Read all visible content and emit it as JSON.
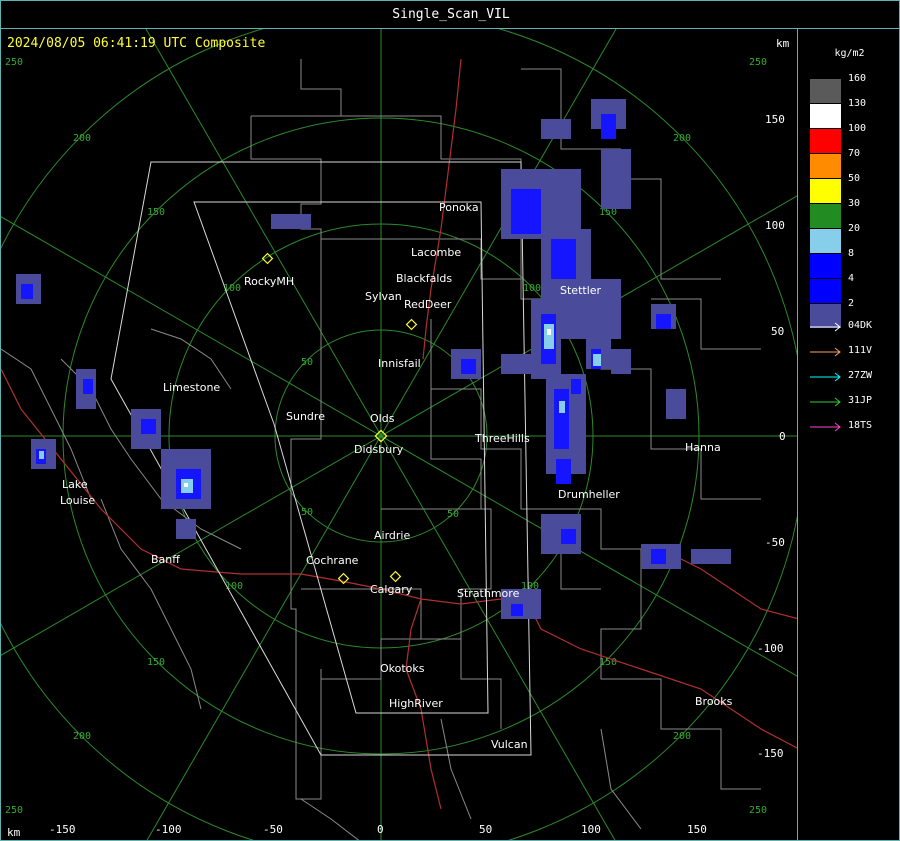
{
  "window": {
    "title": "Single_Scan_VIL"
  },
  "map": {
    "timestamp": "2024/08/05 06:41:19 UTC Composite",
    "km_label_top": "km",
    "km_label_bottom": "km",
    "x_ticks": [
      "-150",
      "-100",
      "-50",
      "0",
      "50",
      "100",
      "150"
    ],
    "y_ticks": [
      "150",
      "100",
      "50",
      "0",
      "-50",
      "-100",
      "-150"
    ],
    "ring_labels": [
      "50",
      "100",
      "150",
      "200",
      "250"
    ],
    "towns": {
      "ponoka": "Ponoka",
      "lacombe": "Lacombe",
      "blackfalds": "Blackfalds",
      "sylvan": "Sylvan",
      "reddeer": "RedDeer",
      "rockymh": "RockyMH",
      "stettler": "Stettler",
      "innisfail": "Innisfail",
      "limestone": "Limestone",
      "sundre": "Sundre",
      "olds": "Olds",
      "didsbury": "Didsbury",
      "threehills": "ThreeHills",
      "hanna": "Hanna",
      "lake": "Lake",
      "louise": "Louise",
      "drumheller": "Drumheller",
      "airdrie": "Airdrie",
      "banff": "Banff",
      "cochrane": "Cochrane",
      "calgary": "Calgary",
      "strathmore": "Strathmore",
      "okotoks": "Okotoks",
      "highriver": "HighRiver",
      "brooks": "Brooks",
      "vulcan": "Vulcan"
    }
  },
  "legend": {
    "units": "kg/m2",
    "scale": [
      {
        "label": "160",
        "color": "#5a5a5a"
      },
      {
        "label": "130",
        "color": "#ffffff"
      },
      {
        "label": "100",
        "color": "#ff0000"
      },
      {
        "label": "70",
        "color": "#ff8c00"
      },
      {
        "label": "50",
        "color": "#ffff00"
      },
      {
        "label": "30",
        "color": "#228b22"
      },
      {
        "label": "20",
        "color": "#87ceeb"
      },
      {
        "label": "8",
        "color": "#0000ff"
      },
      {
        "label": "4",
        "color": "#0000ff"
      },
      {
        "label": "2",
        "color": "#4b4b9c"
      }
    ],
    "sites": [
      {
        "label": "04DK",
        "color": "#ffffff"
      },
      {
        "label": "111V",
        "color": "#f4a460"
      },
      {
        "label": "27ZW",
        "color": "#00ffff"
      },
      {
        "label": "31JP",
        "color": "#33cc33"
      },
      {
        "label": "18TS",
        "color": "#ff44cc"
      }
    ]
  }
}
